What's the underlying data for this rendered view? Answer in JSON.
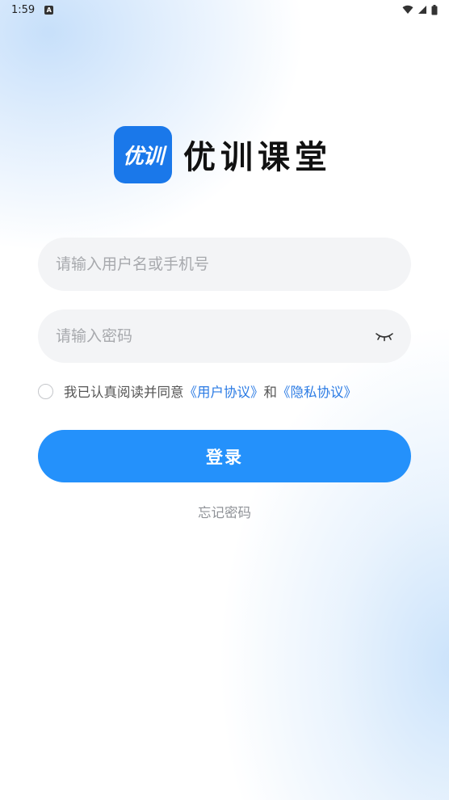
{
  "status_bar": {
    "time": "1:59",
    "notification_icon": "a-badge-icon",
    "right_icons": [
      "wifi-icon",
      "signal-icon",
      "battery-icon"
    ]
  },
  "logo": {
    "badge_text": "优训",
    "app_name": "优训课堂"
  },
  "form": {
    "username_placeholder": "请输入用户名或手机号",
    "username_value": "",
    "password_placeholder": "请输入密码",
    "password_value": "",
    "password_toggle_icon": "eye-closed-icon"
  },
  "agreement": {
    "prefix": "我已认真阅读并同意",
    "user_agreement": "《用户协议》",
    "and": "和",
    "privacy_policy": "《隐私协议》",
    "checked": false
  },
  "login_button": "登录",
  "forgot_password": "忘记密码",
  "colors": {
    "primary": "#2491fb",
    "link": "#2b7be4",
    "logo_badge": "#1a78ea",
    "field_bg": "#f3f4f6"
  }
}
